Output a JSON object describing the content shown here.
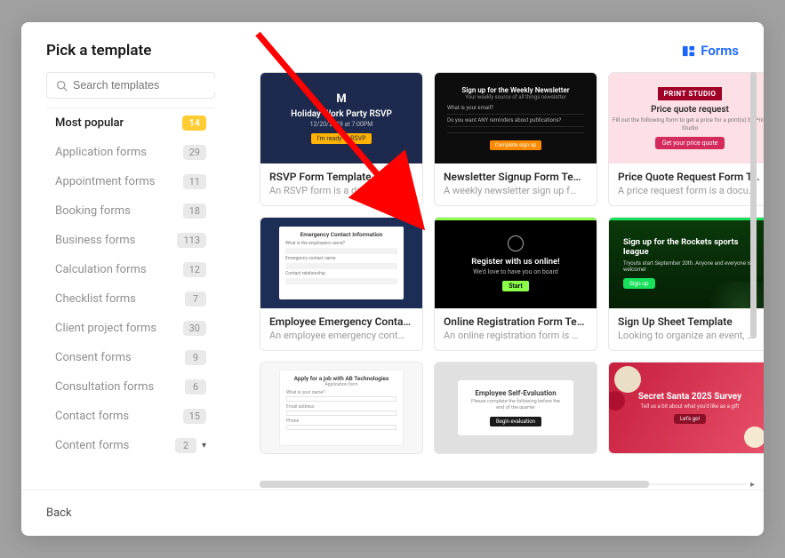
{
  "header": {
    "title": "Pick a template",
    "brand": "Forms"
  },
  "search": {
    "placeholder": "Search templates"
  },
  "categories": [
    {
      "label": "Most popular",
      "count": "14",
      "active": true
    },
    {
      "label": "Application forms",
      "count": "29"
    },
    {
      "label": "Appointment forms",
      "count": "11"
    },
    {
      "label": "Booking forms",
      "count": "18"
    },
    {
      "label": "Business forms",
      "count": "113"
    },
    {
      "label": "Calculation forms",
      "count": "12"
    },
    {
      "label": "Checklist forms",
      "count": "7"
    },
    {
      "label": "Client project forms",
      "count": "30"
    },
    {
      "label": "Consent forms",
      "count": "9"
    },
    {
      "label": "Consultation forms",
      "count": "6"
    },
    {
      "label": "Contact forms",
      "count": "15"
    },
    {
      "label": "Content forms",
      "count": "2"
    }
  ],
  "templates": [
    {
      "title": "RSVP Form Template",
      "desc": "An RSVP form is a documen…",
      "thumb": {
        "kind": "rsvp",
        "logo": "M",
        "heading": "Holiday Work Party RSVP",
        "sub": "12/20/2019 at 7:00PM",
        "cta": "I'm ready to RSVP"
      }
    },
    {
      "title": "Newsletter Signup Form Tem…",
      "desc": "A weekly newsletter sign up f…",
      "thumb": {
        "kind": "news",
        "heading": "Sign up for the Weekly Newsletter",
        "sub": "Your weekly source of all things newsletter",
        "q1": "What is your email?",
        "q2": "Do you want ANY reminders about publications?",
        "cta": "Complete sign up"
      }
    },
    {
      "title": "Price Quote Request Form Te…",
      "desc": "A price request form is a docu…",
      "thumb": {
        "kind": "price",
        "brand": "PRINT STUDIO",
        "heading": "Price quote request",
        "sub": "Fill out the following form to get a price for a print(s) by Print Studio",
        "cta": "Get your price quote"
      }
    },
    {
      "title": "Employee Emergency Contac…",
      "desc": "An employee emergency cont…",
      "thumb": {
        "kind": "emerg",
        "heading": "Emergency Contact Information"
      }
    },
    {
      "title": "Online Registration Form Tem…",
      "desc": "An online registration form is …",
      "thumb": {
        "kind": "register",
        "heading": "Register with us online!",
        "sub": "We'd love to have you on board",
        "cta": "Start"
      }
    },
    {
      "title": "Sign Up Sheet Template",
      "desc": "Looking to organize an event, …",
      "thumb": {
        "kind": "sports",
        "heading": "Sign up for the Rockets sports league",
        "sub": "Tryouts start September 20th. Anyone and everyone is welcome!",
        "cta": "Sign up"
      }
    },
    {
      "title": "",
      "desc": "",
      "thumb": {
        "kind": "job",
        "heading": "Apply for a job with AB Technologies"
      }
    },
    {
      "title": "",
      "desc": "",
      "thumb": {
        "kind": "eval",
        "heading": "Employee Self-Evaluation",
        "sub": "Please complete the following before the end of the quarter",
        "cta": "Begin evaluation"
      }
    },
    {
      "title": "",
      "desc": "",
      "thumb": {
        "kind": "santa",
        "heading": "Secret Santa 2025 Survey",
        "sub": "Tell us a bit about what you'd like as a gift",
        "cta": "Let's go!"
      }
    }
  ],
  "footer": {
    "back": "Back"
  }
}
